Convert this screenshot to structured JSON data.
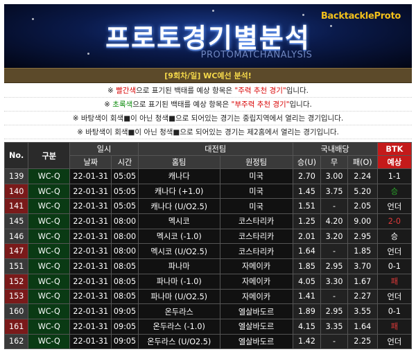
{
  "banner": {
    "brand": "BacktackleProto",
    "title": "프로토경기별분석",
    "subtitle": "PROTOMATCHANALYSIS"
  },
  "round_label": "[9회차/일] WC예선 분석!",
  "notes": {
    "n1": {
      "a": "※ ",
      "red": "빨간색",
      "b": "으로 표기된 백태를 예상 항목은 ",
      "c": "\"주력 추천 경기\"",
      "d": "입니다."
    },
    "n2": {
      "a": "※ ",
      "green": "초록색",
      "b": "으로 표기된 백태를 예상 항목은 ",
      "c": "\"부주력 추천 경기\"",
      "d": "입니다."
    },
    "n3": "※ 바탕색이 회색■이 아닌 청색■으로 되어있는 경기는 중립지역에서 열리는 경기입니다.",
    "n4": "※ 바탕색이 회색■이 아닌 청색■으로 되어있는 경기는 제2홈에서 열리는 경기입니다."
  },
  "table": {
    "headers": {
      "no": "No.",
      "kind": "구분",
      "datetime": "일시",
      "teams": "대전팀",
      "odds": "국내배당",
      "btk": "BTK",
      "date": "날짜",
      "time": "시간",
      "home": "홈팀",
      "away": "원정팀",
      "win": "승(U)",
      "draw": "무",
      "loss": "패(O)",
      "pred": "예상"
    },
    "rows": [
      {
        "no": "139",
        "kind": "WC-Q",
        "date": "22-01-31",
        "time": "05:05",
        "home": "캐나다",
        "away": "미국",
        "win": "2.70",
        "draw": "3.00",
        "loss": "2.24",
        "pred": "1-1",
        "pred_style": "normal",
        "no_style": "dark"
      },
      {
        "no": "140",
        "kind": "WC-Q",
        "date": "22-01-31",
        "time": "05:05",
        "home": "캐나다 (+1.0)",
        "away": "미국",
        "win": "1.45",
        "draw": "3.75",
        "loss": "5.20",
        "pred": "승",
        "pred_style": "win",
        "no_style": "red"
      },
      {
        "no": "141",
        "kind": "WC-Q",
        "date": "22-01-31",
        "time": "05:05",
        "home": "캐나다 (U/O2.5)",
        "away": "미국",
        "win": "1.51",
        "draw": "-",
        "loss": "2.05",
        "pred": "언더",
        "pred_style": "normal",
        "no_style": "red"
      },
      {
        "no": "145",
        "kind": "WC-Q",
        "date": "22-01-31",
        "time": "08:00",
        "home": "멕시코",
        "away": "코스타리카",
        "win": "1.25",
        "draw": "4.20",
        "loss": "9.00",
        "pred": "2-0",
        "pred_style": "loss",
        "no_style": "dark"
      },
      {
        "no": "146",
        "kind": "WC-Q",
        "date": "22-01-31",
        "time": "08:00",
        "home": "멕시코 (-1.0)",
        "away": "코스타리카",
        "win": "2.01",
        "draw": "3.20",
        "loss": "2.95",
        "pred": "승",
        "pred_style": "normal",
        "no_style": "dark"
      },
      {
        "no": "147",
        "kind": "WC-Q",
        "date": "22-01-31",
        "time": "08:00",
        "home": "멕시코 (U/O2.5)",
        "away": "코스타리카",
        "win": "1.64",
        "draw": "-",
        "loss": "1.85",
        "pred": "언더",
        "pred_style": "normal",
        "no_style": "red"
      },
      {
        "no": "151",
        "kind": "WC-Q",
        "date": "22-01-31",
        "time": "08:05",
        "home": "파나마",
        "away": "자메이카",
        "win": "1.85",
        "draw": "2.95",
        "loss": "3.70",
        "pred": "0-1",
        "pred_style": "normal",
        "no_style": "dark"
      },
      {
        "no": "152",
        "kind": "WC-Q",
        "date": "22-01-31",
        "time": "08:05",
        "home": "파나마 (-1.0)",
        "away": "자메이카",
        "win": "4.05",
        "draw": "3.30",
        "loss": "1.67",
        "pred": "패",
        "pred_style": "loss",
        "no_style": "red"
      },
      {
        "no": "153",
        "kind": "WC-Q",
        "date": "22-01-31",
        "time": "08:05",
        "home": "파나마 (U/O2.5)",
        "away": "자메이카",
        "win": "1.41",
        "draw": "-",
        "loss": "2.27",
        "pred": "언더",
        "pred_style": "normal",
        "no_style": "red"
      },
      {
        "no": "160",
        "kind": "WC-Q",
        "date": "22-01-31",
        "time": "09:05",
        "home": "온두라스",
        "away": "엘살바도르",
        "win": "1.89",
        "draw": "2.95",
        "loss": "3.55",
        "pred": "0-1",
        "pred_style": "normal",
        "no_style": "dark"
      },
      {
        "no": "161",
        "kind": "WC-Q",
        "date": "22-01-31",
        "time": "09:05",
        "home": "온두라스 (-1.0)",
        "away": "엘살바도르",
        "win": "4.15",
        "draw": "3.35",
        "loss": "1.64",
        "pred": "패",
        "pred_style": "loss",
        "no_style": "red"
      },
      {
        "no": "162",
        "kind": "WC-Q",
        "date": "22-01-31",
        "time": "09:05",
        "home": "온두라스 (U/O2.5)",
        "away": "엘살바도르",
        "win": "1.42",
        "draw": "-",
        "loss": "2.25",
        "pred": "언더",
        "pred_style": "normal",
        "no_style": "dark"
      }
    ]
  }
}
